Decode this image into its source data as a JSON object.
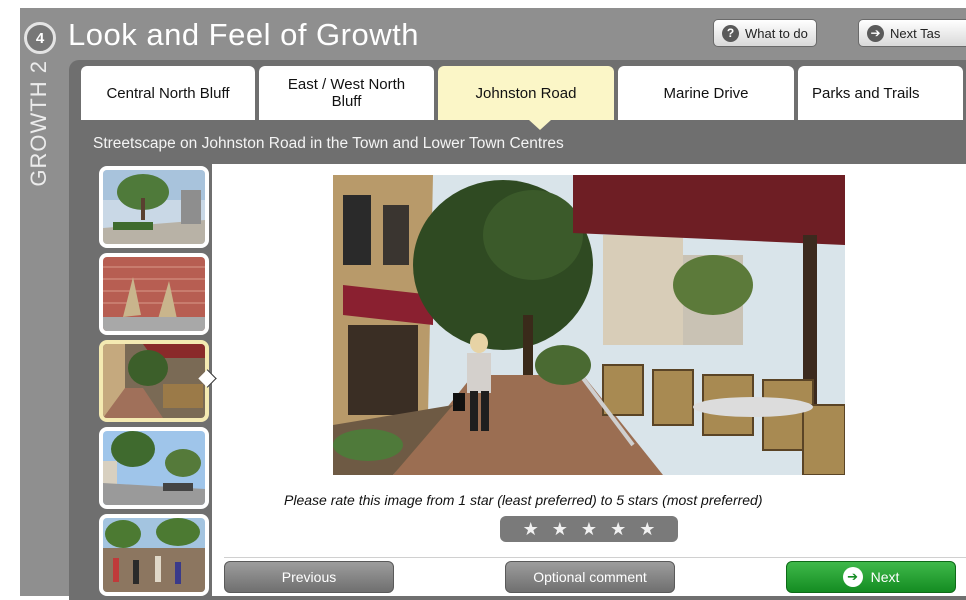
{
  "header": {
    "step_number": "4",
    "title": "Look and Feel of Growth",
    "what_to_do_label": "What to do",
    "next_task_label": "Next Tas"
  },
  "side_label": "GROWTH 2",
  "tabs": [
    {
      "label": "Central North Bluff",
      "active": false
    },
    {
      "label": "East / West North Bluff",
      "active": false
    },
    {
      "label": "Johnston Road",
      "active": true
    },
    {
      "label": "Marine Drive",
      "active": false
    },
    {
      "label": "Parks and Trails",
      "active": false
    }
  ],
  "subtitle": "Streetscape on Johnston Road in the Town and Lower Town Centres",
  "thumbnails": {
    "count": 5,
    "selected_index": 2
  },
  "rating": {
    "prompt": "Please rate this image from 1 star (least preferred) to 5 stars (most preferred)",
    "max_stars": 5,
    "current": 0
  },
  "footer": {
    "previous_label": "Previous",
    "comment_label": "Optional comment",
    "next_label": "Next"
  },
  "colors": {
    "frame": "#8f8f8f",
    "panel": "#6f6f6f",
    "active_tab": "#fbf6c7",
    "next_button": "#148c22"
  }
}
